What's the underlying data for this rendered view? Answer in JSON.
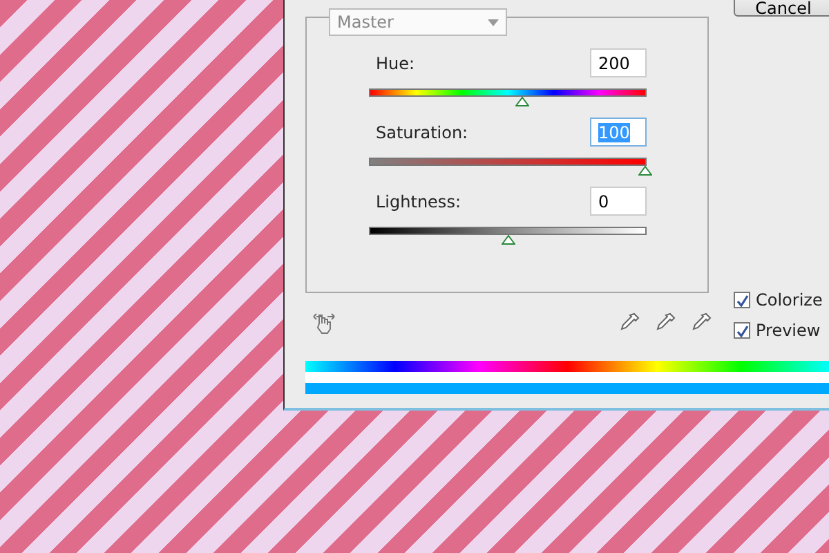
{
  "dialog": {
    "cancel_button": "Cancel",
    "preset": {
      "value": "Master"
    },
    "adjustments": [
      {
        "label": "Hue:",
        "value": "200",
        "selected": false,
        "kind": "hue",
        "level": 0.555
      },
      {
        "label": "Saturation:",
        "value": "100",
        "selected": true,
        "kind": "saturation",
        "level": 1
      },
      {
        "label": "Lightness:",
        "value": "0",
        "selected": false,
        "kind": "lightness",
        "level": 0.5
      }
    ],
    "options": [
      {
        "label": "Colorize",
        "checked": true
      },
      {
        "label": "Preview",
        "checked": true
      }
    ]
  }
}
